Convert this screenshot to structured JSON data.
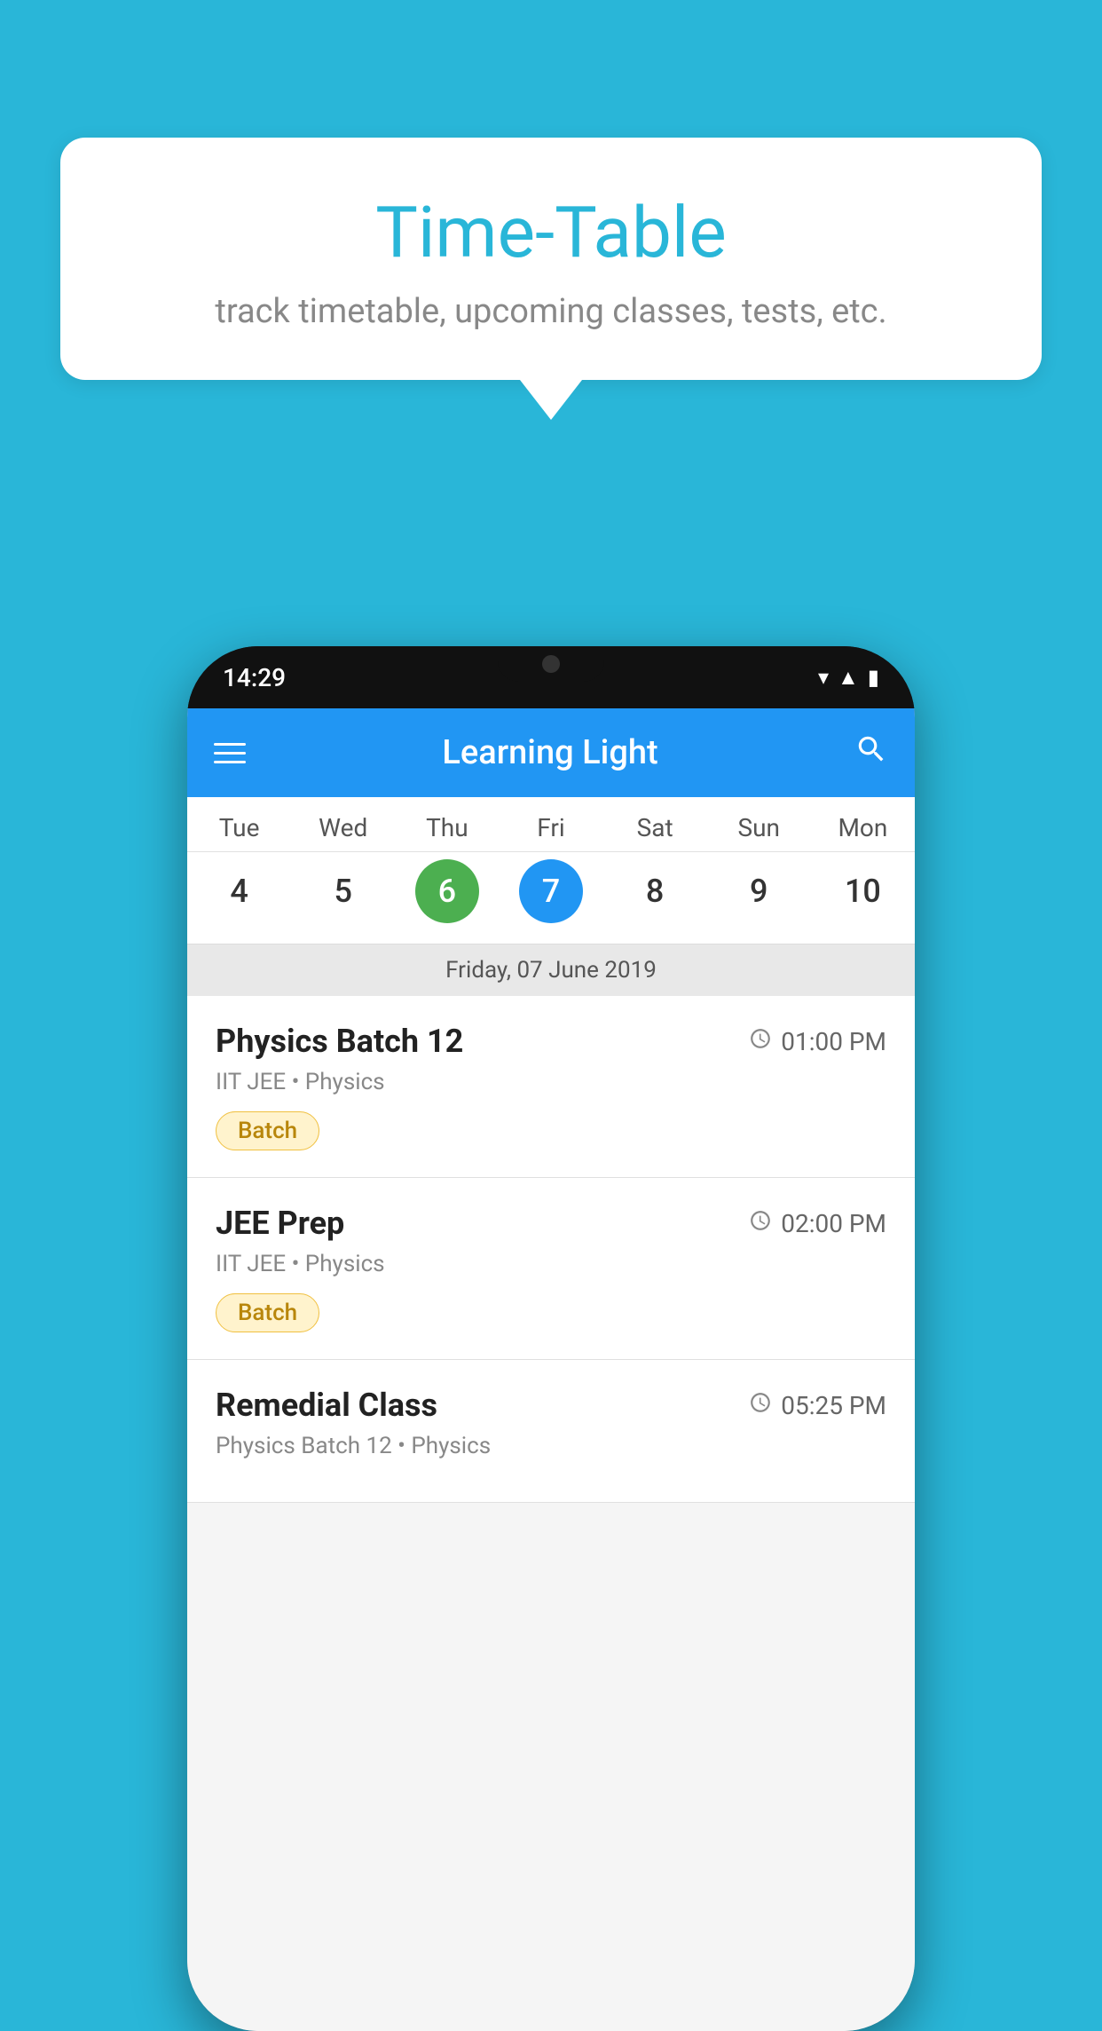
{
  "background_color": "#29b6d8",
  "speech_bubble": {
    "title": "Time-Table",
    "subtitle": "track timetable, upcoming classes, tests, etc."
  },
  "phone": {
    "status_bar": {
      "time": "14:29"
    },
    "app_bar": {
      "title": "Learning Light",
      "search_label": "search"
    },
    "calendar": {
      "days": [
        "Tue",
        "Wed",
        "Thu",
        "Fri",
        "Sat",
        "Sun",
        "Mon"
      ],
      "dates": [
        {
          "num": "4",
          "state": "normal"
        },
        {
          "num": "5",
          "state": "normal"
        },
        {
          "num": "6",
          "state": "today"
        },
        {
          "num": "7",
          "state": "selected"
        },
        {
          "num": "8",
          "state": "normal"
        },
        {
          "num": "9",
          "state": "normal"
        },
        {
          "num": "10",
          "state": "normal"
        }
      ],
      "selected_date_label": "Friday, 07 June 2019"
    },
    "classes": [
      {
        "name": "Physics Batch 12",
        "time": "01:00 PM",
        "meta": "IIT JEE • Physics",
        "tag": "Batch"
      },
      {
        "name": "JEE Prep",
        "time": "02:00 PM",
        "meta": "IIT JEE • Physics",
        "tag": "Batch"
      },
      {
        "name": "Remedial Class",
        "time": "05:25 PM",
        "meta": "Physics Batch 12 • Physics",
        "tag": ""
      }
    ]
  }
}
